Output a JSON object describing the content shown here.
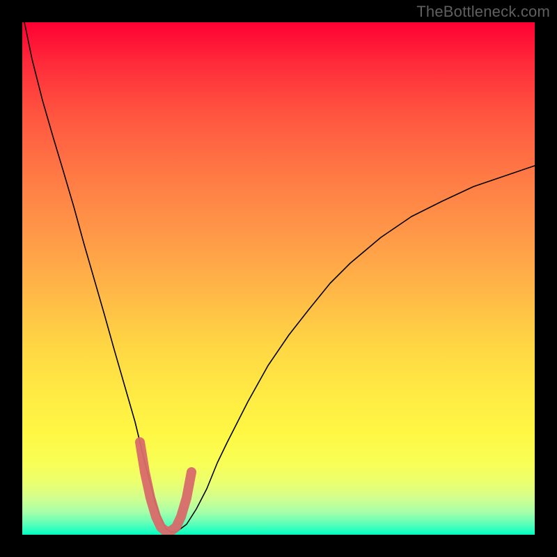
{
  "watermark": "TheBottleneck.com",
  "chart_data": {
    "type": "line",
    "title": "",
    "xlabel": "",
    "ylabel": "",
    "xlim": [
      0,
      100
    ],
    "ylim": [
      0,
      100
    ],
    "grid": false,
    "legend": false,
    "series": [
      {
        "name": "bottleneck-curve",
        "color": "#000000",
        "x": [
          0,
          2,
          4,
          6,
          8,
          10,
          12,
          14,
          16,
          18,
          20,
          22,
          23,
          24,
          25,
          26,
          27,
          28,
          29,
          30,
          31,
          32,
          34,
          36,
          38,
          40,
          44,
          48,
          52,
          56,
          60,
          64,
          70,
          76,
          82,
          88,
          94,
          100
        ],
        "y": [
          102,
          93,
          85,
          78,
          71,
          64,
          57,
          50,
          43,
          36,
          29,
          22,
          18,
          14,
          10,
          6,
          3,
          1,
          0.5,
          0.5,
          1,
          2,
          5,
          9,
          14,
          18,
          26,
          33,
          39,
          44,
          49,
          53,
          58,
          62,
          65,
          68,
          70,
          72
        ]
      },
      {
        "name": "optimal-zone-marker",
        "color": "#e06666",
        "x": [
          23,
          24,
          25,
          26,
          27,
          28,
          29,
          30,
          31,
          32,
          33
        ],
        "y": [
          18,
          12,
          7,
          3.5,
          1.5,
          0.7,
          0.7,
          1.5,
          3.5,
          7,
          12
        ]
      }
    ],
    "background_gradient": {
      "type": "vertical",
      "stops": [
        {
          "pos": 0,
          "color": "#ff0033"
        },
        {
          "pos": 50,
          "color": "#ffc045"
        },
        {
          "pos": 80,
          "color": "#fff744"
        },
        {
          "pos": 100,
          "color": "#00ffbe"
        }
      ]
    }
  }
}
